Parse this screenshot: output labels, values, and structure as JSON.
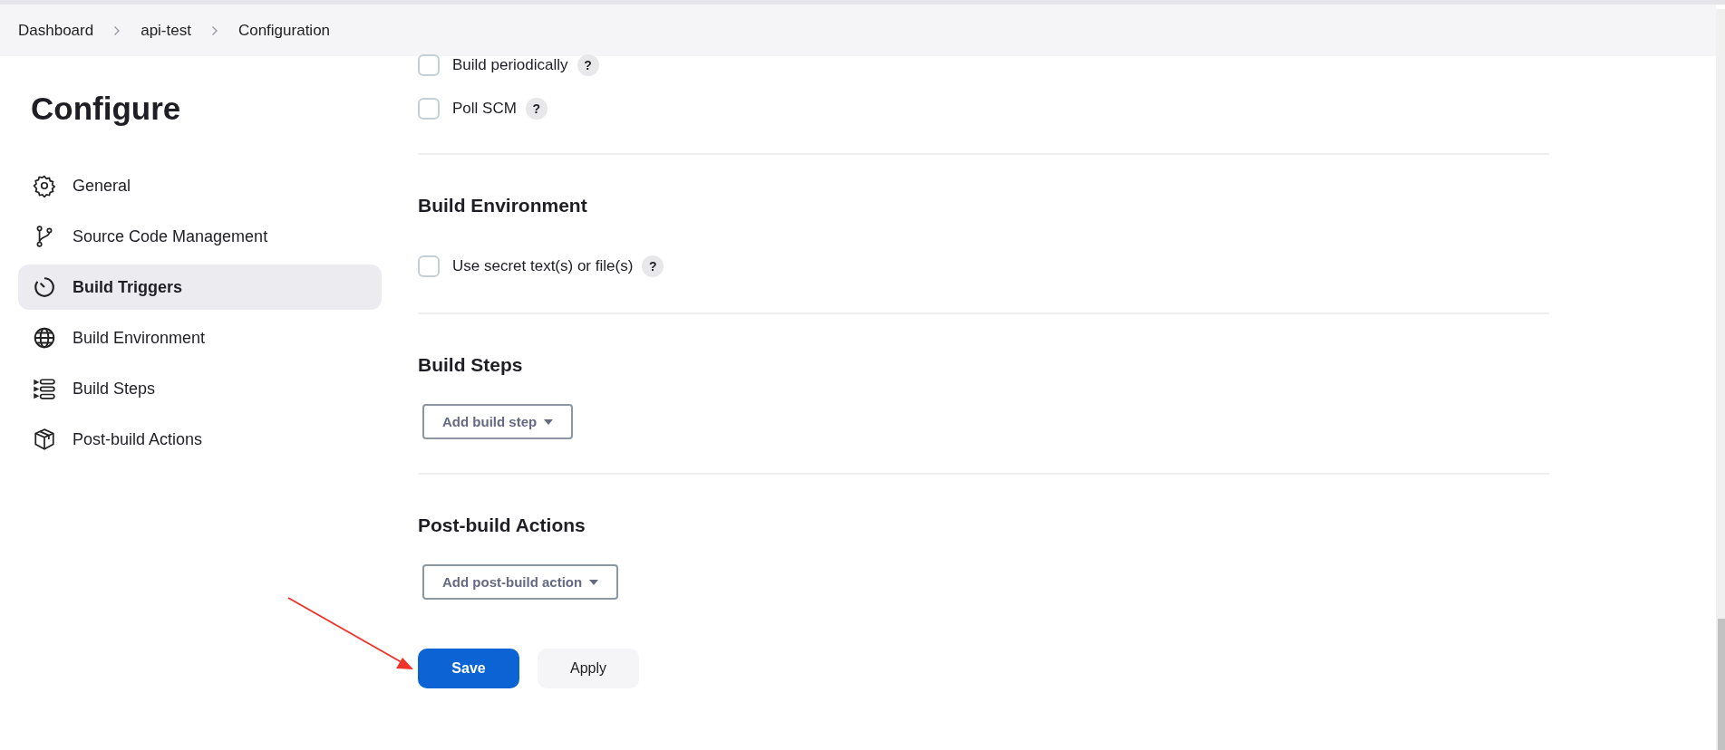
{
  "breadcrumbs": [
    "Dashboard",
    "api-test",
    "Configuration"
  ],
  "sidebar": {
    "title": "Configure",
    "items": [
      {
        "label": "General",
        "selected": false
      },
      {
        "label": "Source Code Management",
        "selected": false
      },
      {
        "label": "Build Triggers",
        "selected": true
      },
      {
        "label": "Build Environment",
        "selected": false
      },
      {
        "label": "Build Steps",
        "selected": false
      },
      {
        "label": "Post-build Actions",
        "selected": false
      }
    ]
  },
  "sections": [
    {
      "options": [
        {
          "label": "Build periodically",
          "checked": false,
          "help": "?"
        },
        {
          "label": "Poll SCM",
          "checked": false,
          "help": "?"
        }
      ]
    },
    {
      "title": "Build Environment",
      "options": [
        {
          "label": "Use secret text(s) or file(s)",
          "checked": false,
          "help": "?"
        }
      ]
    },
    {
      "title": "Build Steps",
      "dropdown": "Add build step"
    },
    {
      "title": "Post-build Actions",
      "dropdown": "Add post-build action"
    }
  ],
  "buttons": [
    {
      "label": "Save",
      "kind": "primary"
    },
    {
      "label": "Apply",
      "kind": "secondary"
    }
  ]
}
